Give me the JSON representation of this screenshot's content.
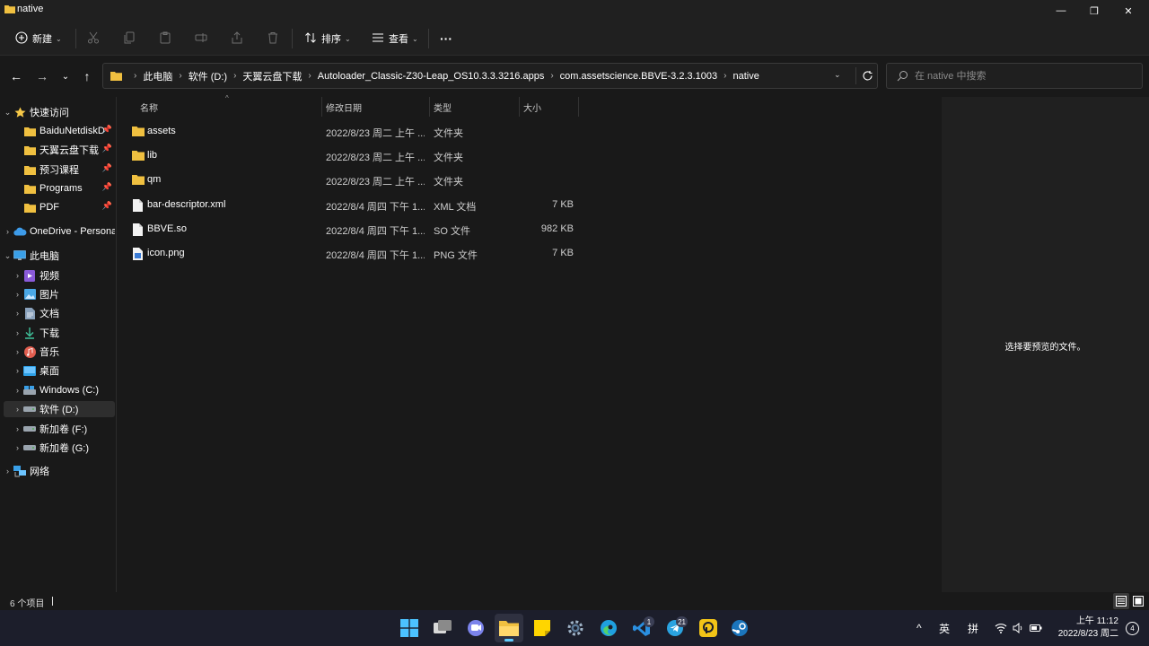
{
  "window": {
    "title": "native",
    "minimize_glyph": "—",
    "maximize_glyph": "❐",
    "close_glyph": "✕"
  },
  "toolbar": {
    "new_label": "新建",
    "sort_label": "排序",
    "view_label": "查看",
    "more_label": "···"
  },
  "address": {
    "crumbs": [
      "此电脑",
      "软件 (D:)",
      "天翼云盘下载",
      "Autoloader_Classic-Z30-Leap_OS10.3.3.3216.apps",
      "com.assetscience.BBVE-3.2.3.1003",
      "native"
    ]
  },
  "search": {
    "placeholder": "在 native 中搜索"
  },
  "sidebar": {
    "items": [
      {
        "label": "快速访问",
        "icon": "star-icon"
      },
      {
        "label": "BaiduNetdiskD",
        "icon": "folder-icon",
        "pinned": true
      },
      {
        "label": "天翼云盘下载",
        "icon": "folder-icon",
        "pinned": true
      },
      {
        "label": "预习课程",
        "icon": "folder-icon",
        "pinned": true
      },
      {
        "label": "Programs",
        "icon": "folder-icon",
        "pinned": true
      },
      {
        "label": "PDF",
        "icon": "folder-icon",
        "pinned": true
      },
      {
        "label": "OneDrive - Personal",
        "icon": "cloud-icon"
      },
      {
        "label": "此电脑",
        "icon": "monitor-icon"
      },
      {
        "label": "视频",
        "icon": "video-icon"
      },
      {
        "label": "图片",
        "icon": "picture-icon"
      },
      {
        "label": "文档",
        "icon": "document-icon"
      },
      {
        "label": "下载",
        "icon": "download-icon"
      },
      {
        "label": "音乐",
        "icon": "music-icon"
      },
      {
        "label": "桌面",
        "icon": "desktop-icon"
      },
      {
        "label": "Windows (C:)",
        "icon": "drive-icon"
      },
      {
        "label": "软件 (D:)",
        "icon": "drive-icon"
      },
      {
        "label": "新加卷 (F:)",
        "icon": "drive-icon"
      },
      {
        "label": "新加卷 (G:)",
        "icon": "drive-icon"
      },
      {
        "label": "网络",
        "icon": "network-icon"
      }
    ]
  },
  "columns": {
    "name": "名称",
    "modified": "修改日期",
    "type": "类型",
    "size": "大小"
  },
  "files": [
    {
      "name": "assets",
      "modified": "2022/8/23 周二 上午 ...",
      "type": "文件夹",
      "size": "",
      "icon": "folder-icon"
    },
    {
      "name": "lib",
      "modified": "2022/8/23 周二 上午 ...",
      "type": "文件夹",
      "size": "",
      "icon": "folder-icon"
    },
    {
      "name": "qm",
      "modified": "2022/8/23 周二 上午 ...",
      "type": "文件夹",
      "size": "",
      "icon": "folder-icon"
    },
    {
      "name": "bar-descriptor.xml",
      "modified": "2022/8/4 周四 下午 1...",
      "type": "XML 文档",
      "size": "7 KB",
      "icon": "file-icon"
    },
    {
      "name": "BBVE.so",
      "modified": "2022/8/4 周四 下午 1...",
      "type": "SO 文件",
      "size": "982 KB",
      "icon": "file-icon"
    },
    {
      "name": "icon.png",
      "modified": "2022/8/4 周四 下午 1...",
      "type": "PNG 文件",
      "size": "7 KB",
      "icon": "image-file-icon"
    }
  ],
  "preview": {
    "message": "选择要预览的文件。"
  },
  "status": {
    "item_count": "6 个项目"
  },
  "taskbar": {
    "badges": {
      "vscode": "1",
      "telegram": "21"
    },
    "tray": {
      "ime_lang": "英",
      "ime_mode": "拼",
      "chevron": "^"
    },
    "time": "上午 11:12",
    "date": "2022/8/23 周二",
    "notifications": "4"
  },
  "colors": {
    "accent": "#60cdff",
    "folder": "#f0c040",
    "background": "#191919",
    "preview_bg": "#202020",
    "taskbar_bg": "#1c1e2b"
  }
}
